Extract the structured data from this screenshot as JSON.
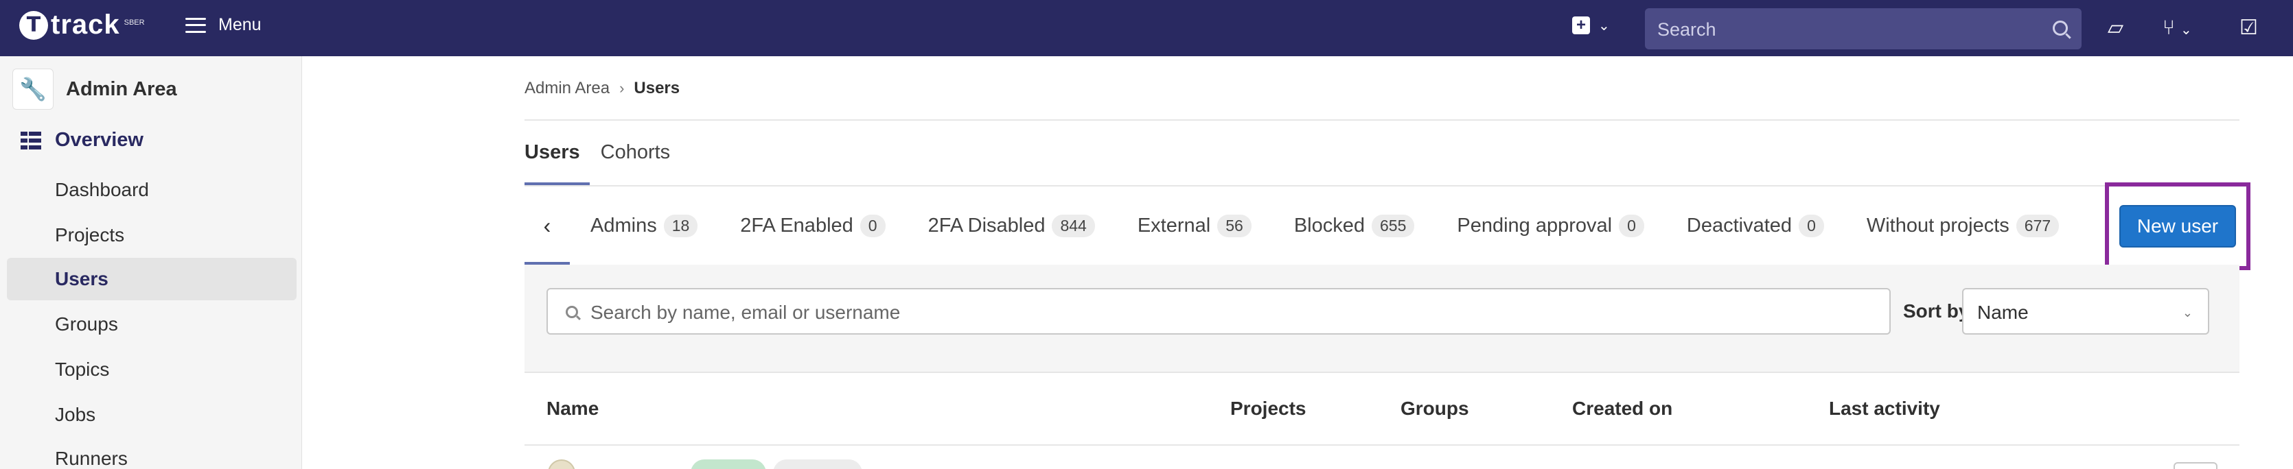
{
  "navbar": {
    "logo_text": "track",
    "logo_sub": "SBER",
    "menu_label": "Menu",
    "search_placeholder": "Search",
    "bg_color": "#292961"
  },
  "sidebar": {
    "header": "Admin Area",
    "section": "Overview",
    "items": [
      {
        "label": "Dashboard",
        "active": false
      },
      {
        "label": "Projects",
        "active": false
      },
      {
        "label": "Users",
        "active": true
      },
      {
        "label": "Groups",
        "active": false
      },
      {
        "label": "Topics",
        "active": false
      },
      {
        "label": "Jobs",
        "active": false
      },
      {
        "label": "Runners",
        "active": false
      }
    ]
  },
  "breadcrumb": {
    "parent": "Admin Area",
    "current": "Users"
  },
  "top_tabs": [
    {
      "label": "Users",
      "active": true
    },
    {
      "label": "Cohorts",
      "active": false
    }
  ],
  "filter_tabs": [
    {
      "label": "Admins",
      "count": "18"
    },
    {
      "label": "2FA Enabled",
      "count": "0"
    },
    {
      "label": "2FA Disabled",
      "count": "844"
    },
    {
      "label": "External",
      "count": "56"
    },
    {
      "label": "Blocked",
      "count": "655"
    },
    {
      "label": "Pending approval",
      "count": "0"
    },
    {
      "label": "Deactivated",
      "count": "0"
    },
    {
      "label": "Without projects",
      "count": "677"
    }
  ],
  "new_user_label": "New user",
  "search": {
    "placeholder": "Search by name, email or username"
  },
  "sort": {
    "label": "Sort by",
    "value": "Name"
  },
  "table": {
    "columns": [
      "Name",
      "Projects",
      "Groups",
      "Created on",
      "Last activity"
    ]
  },
  "accent_color": "#1f75cb"
}
